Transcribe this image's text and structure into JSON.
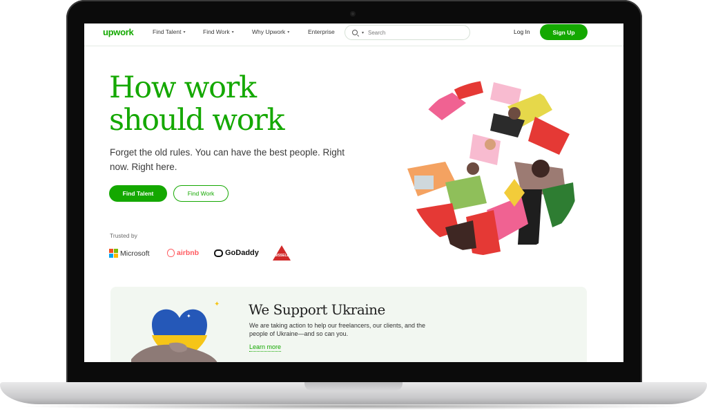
{
  "nav": {
    "logo": "upwork",
    "items": [
      "Find Talent",
      "Find Work",
      "Why Upwork",
      "Enterprise"
    ],
    "search_placeholder": "Search",
    "login": "Log In",
    "signup": "Sign Up"
  },
  "hero": {
    "title": "How work should work",
    "subtitle": "Forget the old rules. You can have the best people. Right now. Right here.",
    "primary_button": "Find Talent",
    "secondary_button": "Find Work"
  },
  "trusted": {
    "label": "Trusted by",
    "brands": [
      "Microsoft",
      "airbnb",
      "GoDaddy",
      "BISSELL"
    ]
  },
  "ukraine": {
    "title": "We Support Ukraine",
    "body": "We are taking action to help our freelancers, our clients, and the people of Ukraine—and so can you.",
    "link": "Learn more"
  },
  "colors": {
    "brand_green": "#14a800",
    "card_bg": "#f2f7f1"
  },
  "icons": [
    "search-icon",
    "chevron-down-icon",
    "microsoft-logo",
    "airbnb-logo",
    "godaddy-logo",
    "bissell-logo",
    "camera-icon"
  ]
}
